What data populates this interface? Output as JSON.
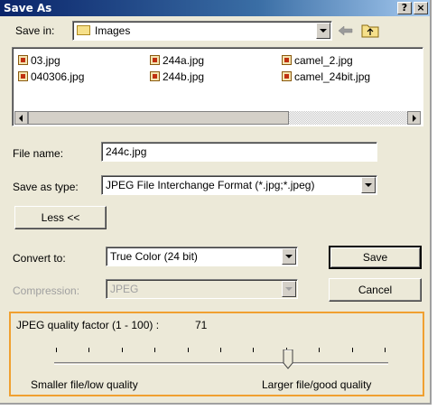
{
  "window": {
    "title": "Save As",
    "help_label": "?",
    "close_label": "×"
  },
  "save_in": {
    "label": "Save in:",
    "value": "Images"
  },
  "files": [
    {
      "name": "03.jpg"
    },
    {
      "name": "244a.jpg"
    },
    {
      "name": "camel_2.jpg"
    },
    {
      "name": "040306.jpg"
    },
    {
      "name": "244b.jpg"
    },
    {
      "name": "camel_24bit.jpg"
    }
  ],
  "file_name": {
    "label": "File name:",
    "value": "244c.jpg"
  },
  "save_as_type": {
    "label": "Save as type:",
    "value": "JPEG File Interchange Format (*.jpg;*.jpeg)"
  },
  "less_button": "Less <<",
  "convert": {
    "label": "Convert to:",
    "value": "True Color (24 bit)"
  },
  "compression": {
    "label": "Compression:",
    "value": "JPEG"
  },
  "buttons": {
    "save": "Save",
    "cancel": "Cancel"
  },
  "quality": {
    "label": "JPEG quality factor (1 - 100) :",
    "value": "71",
    "slider_level": 71,
    "min_label": "Smaller file/low quality",
    "max_label": "Larger file/good quality"
  },
  "colors": {
    "accent": "#f0a030",
    "titlebar": "#0a246a"
  }
}
